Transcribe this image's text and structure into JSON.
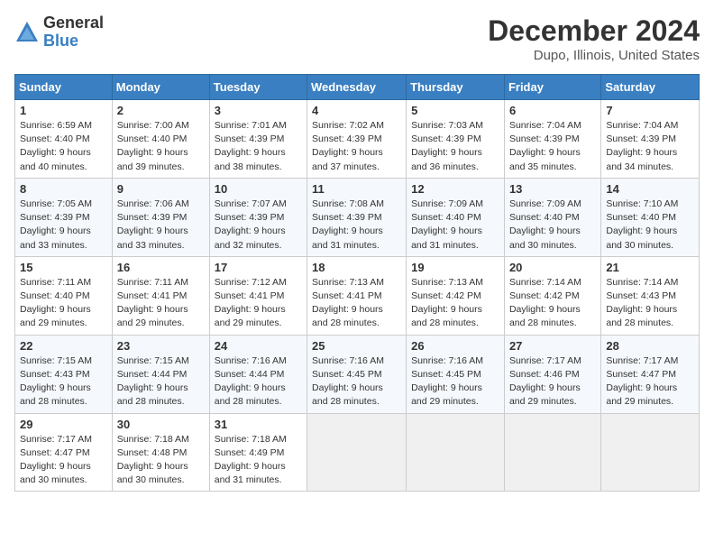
{
  "logo": {
    "general": "General",
    "blue": "Blue"
  },
  "title": "December 2024",
  "subtitle": "Dupo, Illinois, United States",
  "days_of_week": [
    "Sunday",
    "Monday",
    "Tuesday",
    "Wednesday",
    "Thursday",
    "Friday",
    "Saturday"
  ],
  "weeks": [
    [
      {
        "day": 1,
        "sunrise": "6:59 AM",
        "sunset": "4:40 PM",
        "daylight": "9 hours and 40 minutes."
      },
      {
        "day": 2,
        "sunrise": "7:00 AM",
        "sunset": "4:40 PM",
        "daylight": "9 hours and 39 minutes."
      },
      {
        "day": 3,
        "sunrise": "7:01 AM",
        "sunset": "4:39 PM",
        "daylight": "9 hours and 38 minutes."
      },
      {
        "day": 4,
        "sunrise": "7:02 AM",
        "sunset": "4:39 PM",
        "daylight": "9 hours and 37 minutes."
      },
      {
        "day": 5,
        "sunrise": "7:03 AM",
        "sunset": "4:39 PM",
        "daylight": "9 hours and 36 minutes."
      },
      {
        "day": 6,
        "sunrise": "7:04 AM",
        "sunset": "4:39 PM",
        "daylight": "9 hours and 35 minutes."
      },
      {
        "day": 7,
        "sunrise": "7:04 AM",
        "sunset": "4:39 PM",
        "daylight": "9 hours and 34 minutes."
      }
    ],
    [
      {
        "day": 8,
        "sunrise": "7:05 AM",
        "sunset": "4:39 PM",
        "daylight": "9 hours and 33 minutes."
      },
      {
        "day": 9,
        "sunrise": "7:06 AM",
        "sunset": "4:39 PM",
        "daylight": "9 hours and 33 minutes."
      },
      {
        "day": 10,
        "sunrise": "7:07 AM",
        "sunset": "4:39 PM",
        "daylight": "9 hours and 32 minutes."
      },
      {
        "day": 11,
        "sunrise": "7:08 AM",
        "sunset": "4:39 PM",
        "daylight": "9 hours and 31 minutes."
      },
      {
        "day": 12,
        "sunrise": "7:09 AM",
        "sunset": "4:40 PM",
        "daylight": "9 hours and 31 minutes."
      },
      {
        "day": 13,
        "sunrise": "7:09 AM",
        "sunset": "4:40 PM",
        "daylight": "9 hours and 30 minutes."
      },
      {
        "day": 14,
        "sunrise": "7:10 AM",
        "sunset": "4:40 PM",
        "daylight": "9 hours and 30 minutes."
      }
    ],
    [
      {
        "day": 15,
        "sunrise": "7:11 AM",
        "sunset": "4:40 PM",
        "daylight": "9 hours and 29 minutes."
      },
      {
        "day": 16,
        "sunrise": "7:11 AM",
        "sunset": "4:41 PM",
        "daylight": "9 hours and 29 minutes."
      },
      {
        "day": 17,
        "sunrise": "7:12 AM",
        "sunset": "4:41 PM",
        "daylight": "9 hours and 29 minutes."
      },
      {
        "day": 18,
        "sunrise": "7:13 AM",
        "sunset": "4:41 PM",
        "daylight": "9 hours and 28 minutes."
      },
      {
        "day": 19,
        "sunrise": "7:13 AM",
        "sunset": "4:42 PM",
        "daylight": "9 hours and 28 minutes."
      },
      {
        "day": 20,
        "sunrise": "7:14 AM",
        "sunset": "4:42 PM",
        "daylight": "9 hours and 28 minutes."
      },
      {
        "day": 21,
        "sunrise": "7:14 AM",
        "sunset": "4:43 PM",
        "daylight": "9 hours and 28 minutes."
      }
    ],
    [
      {
        "day": 22,
        "sunrise": "7:15 AM",
        "sunset": "4:43 PM",
        "daylight": "9 hours and 28 minutes."
      },
      {
        "day": 23,
        "sunrise": "7:15 AM",
        "sunset": "4:44 PM",
        "daylight": "9 hours and 28 minutes."
      },
      {
        "day": 24,
        "sunrise": "7:16 AM",
        "sunset": "4:44 PM",
        "daylight": "9 hours and 28 minutes."
      },
      {
        "day": 25,
        "sunrise": "7:16 AM",
        "sunset": "4:45 PM",
        "daylight": "9 hours and 28 minutes."
      },
      {
        "day": 26,
        "sunrise": "7:16 AM",
        "sunset": "4:45 PM",
        "daylight": "9 hours and 29 minutes."
      },
      {
        "day": 27,
        "sunrise": "7:17 AM",
        "sunset": "4:46 PM",
        "daylight": "9 hours and 29 minutes."
      },
      {
        "day": 28,
        "sunrise": "7:17 AM",
        "sunset": "4:47 PM",
        "daylight": "9 hours and 29 minutes."
      }
    ],
    [
      {
        "day": 29,
        "sunrise": "7:17 AM",
        "sunset": "4:47 PM",
        "daylight": "9 hours and 30 minutes."
      },
      {
        "day": 30,
        "sunrise": "7:18 AM",
        "sunset": "4:48 PM",
        "daylight": "9 hours and 30 minutes."
      },
      {
        "day": 31,
        "sunrise": "7:18 AM",
        "sunset": "4:49 PM",
        "daylight": "9 hours and 31 minutes."
      },
      null,
      null,
      null,
      null
    ]
  ]
}
